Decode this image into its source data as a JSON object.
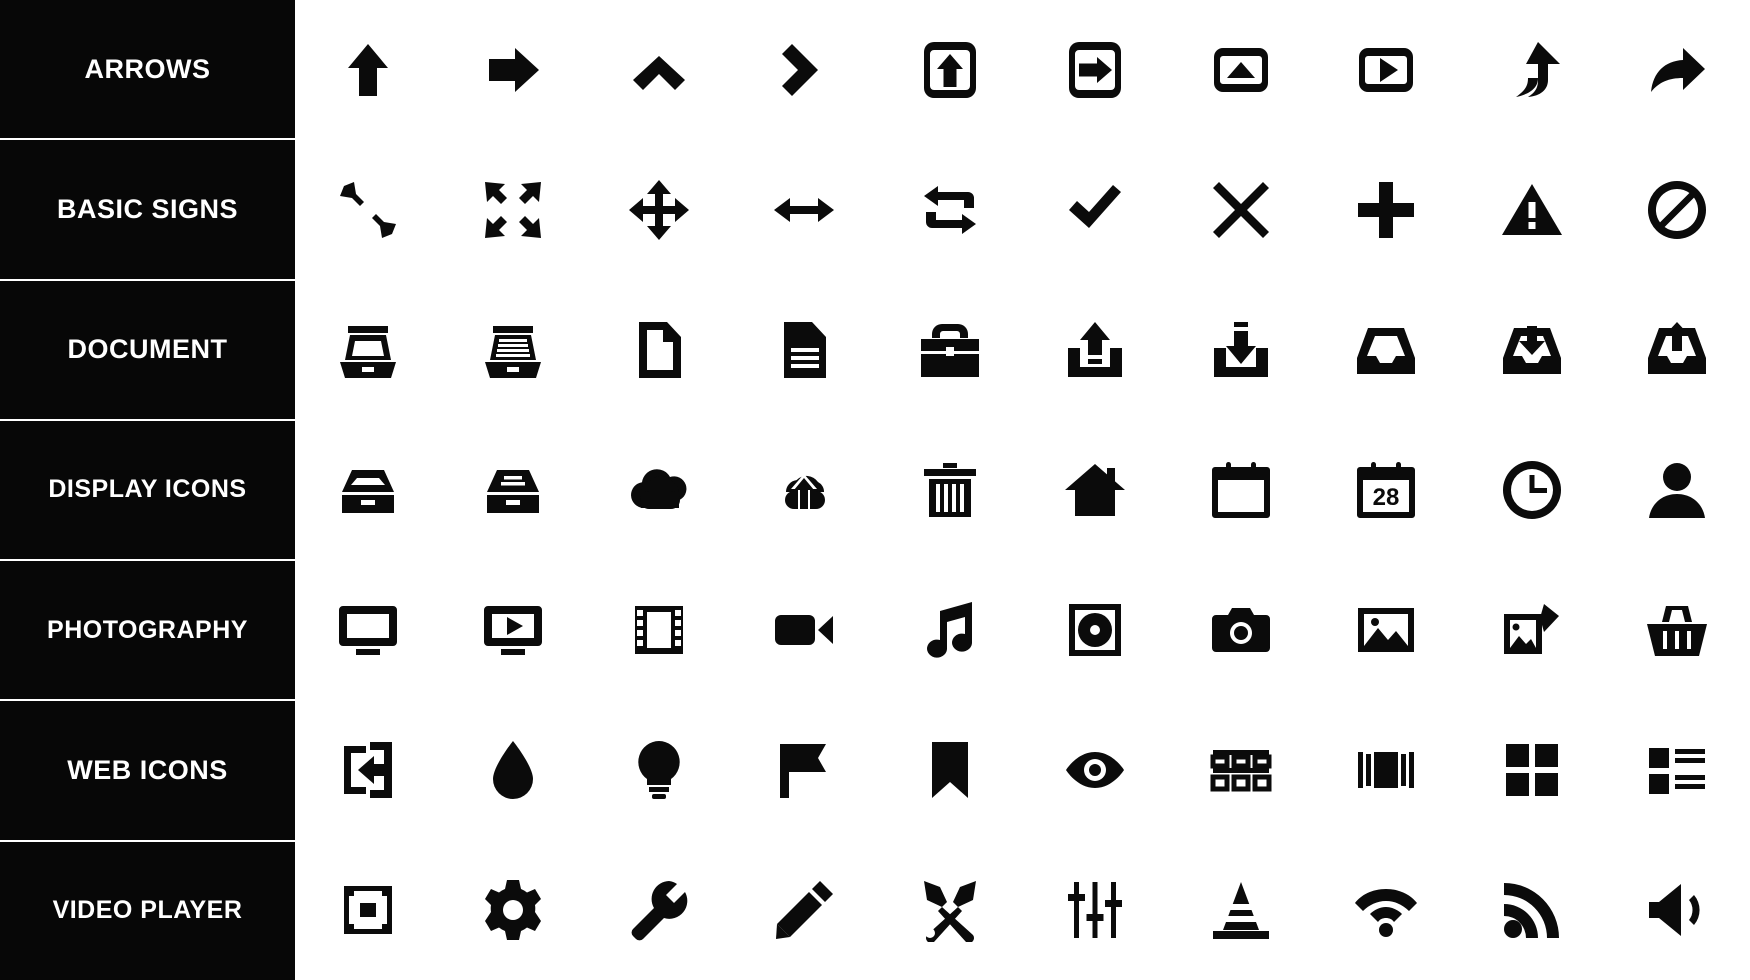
{
  "sheet": {
    "background_color": "#ffffff",
    "label_background_color": "#070707",
    "label_text_color": "#ffffff",
    "icon_color": "#0b0b0b",
    "columns": 10,
    "rows": 7
  },
  "categories": [
    {
      "label": "ARROWS",
      "icons": [
        {
          "name": "arrow-up-icon",
          "label": "arrow up"
        },
        {
          "name": "arrow-right-icon",
          "label": "arrow right"
        },
        {
          "name": "chevron-up-icon",
          "label": "chevron up"
        },
        {
          "name": "chevron-right-icon",
          "label": "chevron right"
        },
        {
          "name": "boxed-arrow-up-icon",
          "label": "arrow up in rounded square"
        },
        {
          "name": "boxed-arrow-right-icon",
          "label": "arrow right in rounded square"
        },
        {
          "name": "boxed-triangle-up-icon",
          "label": "triangle up in rounded square"
        },
        {
          "name": "boxed-play-icon",
          "label": "play triangle in rounded square"
        },
        {
          "name": "curved-arrow-up-icon",
          "label": "curved arrow up"
        },
        {
          "name": "share-arrow-icon",
          "label": "curved share arrow right"
        }
      ]
    },
    {
      "label": "BASIC SIGNS",
      "icons": [
        {
          "name": "collapse-arrows-icon",
          "label": "collapse inward arrows"
        },
        {
          "name": "expand-arrows-icon",
          "label": "expand outward arrows"
        },
        {
          "name": "move-four-way-icon",
          "label": "four way move arrows"
        },
        {
          "name": "resize-horizontal-icon",
          "label": "left right arrow"
        },
        {
          "name": "repeat-loop-icon",
          "label": "repeat loop arrows"
        },
        {
          "name": "check-icon",
          "label": "checkmark"
        },
        {
          "name": "close-x-icon",
          "label": "cross"
        },
        {
          "name": "plus-icon",
          "label": "plus"
        },
        {
          "name": "warning-triangle-icon",
          "label": "warning triangle"
        },
        {
          "name": "forbidden-icon",
          "label": "no entry circle slash"
        }
      ]
    },
    {
      "label": "DOCUMENT",
      "icons": [
        {
          "name": "tray-empty-icon",
          "label": "empty file tray"
        },
        {
          "name": "tray-full-icon",
          "label": "file tray with documents"
        },
        {
          "name": "file-blank-icon",
          "label": "blank file"
        },
        {
          "name": "file-text-icon",
          "label": "file with text lines"
        },
        {
          "name": "briefcase-icon",
          "label": "briefcase"
        },
        {
          "name": "upload-tray-icon",
          "label": "upload to tray"
        },
        {
          "name": "download-tray-icon",
          "label": "download to tray"
        },
        {
          "name": "inbox-icon",
          "label": "inbox"
        },
        {
          "name": "inbox-download-icon",
          "label": "inbox download"
        },
        {
          "name": "inbox-upload-icon",
          "label": "inbox upload"
        }
      ]
    },
    {
      "label": "DISPLAY ICONS",
      "icons": [
        {
          "name": "archive-box-icon",
          "label": "archive box"
        },
        {
          "name": "archive-box-lines-icon",
          "label": "archive box with lines"
        },
        {
          "name": "cloud-icon",
          "label": "cloud"
        },
        {
          "name": "cloud-upload-icon",
          "label": "cloud upload"
        },
        {
          "name": "trash-icon",
          "label": "trash bin"
        },
        {
          "name": "home-icon",
          "label": "house"
        },
        {
          "name": "calendar-icon",
          "label": "calendar"
        },
        {
          "name": "calendar-date-icon",
          "label": "calendar with date",
          "date": "28"
        },
        {
          "name": "clock-icon",
          "label": "clock"
        },
        {
          "name": "user-icon",
          "label": "user avatar"
        }
      ]
    },
    {
      "label": "PHOTOGRAPHY",
      "icons": [
        {
          "name": "monitor-icon",
          "label": "monitor screen"
        },
        {
          "name": "video-player-icon",
          "label": "video player screen"
        },
        {
          "name": "film-strip-icon",
          "label": "film strip"
        },
        {
          "name": "video-camera-icon",
          "label": "video camera"
        },
        {
          "name": "music-note-icon",
          "label": "music note"
        },
        {
          "name": "disc-icon",
          "label": "compact disc in case"
        },
        {
          "name": "camera-icon",
          "label": "photo camera"
        },
        {
          "name": "image-icon",
          "label": "picture frame"
        },
        {
          "name": "images-stack-icon",
          "label": "multiple photos"
        },
        {
          "name": "basket-icon",
          "label": "shopping basket"
        }
      ]
    },
    {
      "label": "WEB ICONS",
      "icons": [
        {
          "name": "login-arrow-icon",
          "label": "sign in arrow into box"
        },
        {
          "name": "droplet-icon",
          "label": "water drop"
        },
        {
          "name": "lightbulb-icon",
          "label": "light bulb"
        },
        {
          "name": "flag-icon",
          "label": "flag"
        },
        {
          "name": "bookmark-icon",
          "label": "bookmark"
        },
        {
          "name": "eye-icon",
          "label": "eye"
        },
        {
          "name": "grid-view-icon",
          "label": "grid thumbnail view"
        },
        {
          "name": "carousel-view-icon",
          "label": "carousel slider view"
        },
        {
          "name": "tiles-view-icon",
          "label": "four tile view"
        },
        {
          "name": "list-view-icon",
          "label": "list with thumbnail view"
        }
      ]
    },
    {
      "label": "VIDEO PLAYER",
      "icons": [
        {
          "name": "crop-frame-icon",
          "label": "crop selection frame"
        },
        {
          "name": "gear-icon",
          "label": "settings gear"
        },
        {
          "name": "wrench-icon",
          "label": "wrench"
        },
        {
          "name": "pencil-icon",
          "label": "pencil"
        },
        {
          "name": "tools-icon",
          "label": "crossed hammer and wrench"
        },
        {
          "name": "equalizer-icon",
          "label": "equalizer sliders"
        },
        {
          "name": "traffic-cone-icon",
          "label": "traffic cone"
        },
        {
          "name": "wifi-icon",
          "label": "wifi signal"
        },
        {
          "name": "rss-icon",
          "label": "rss feed"
        },
        {
          "name": "speaker-icon",
          "label": "speaker volume"
        }
      ]
    }
  ]
}
